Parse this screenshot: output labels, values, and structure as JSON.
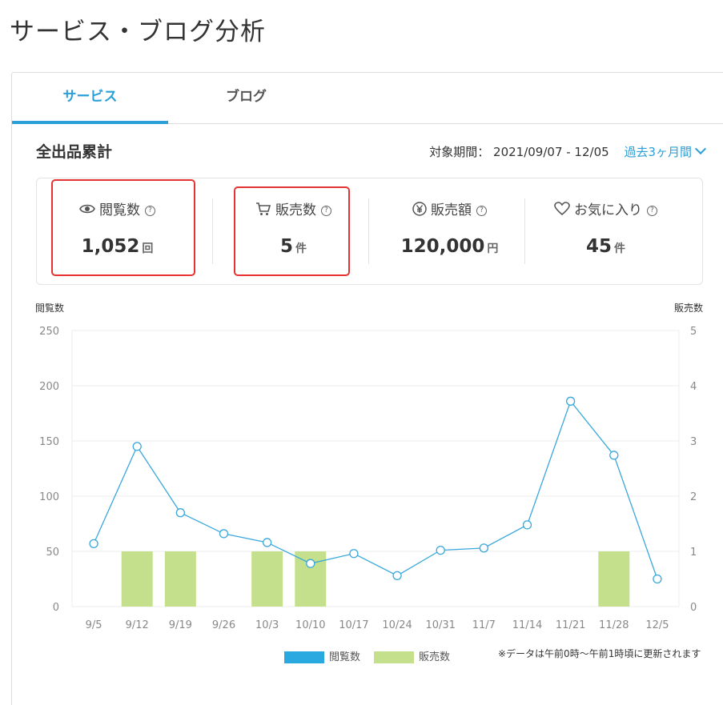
{
  "page": {
    "title": "サービス・ブログ分析"
  },
  "tabs": [
    {
      "label": "サービス",
      "active": true
    },
    {
      "label": "ブログ",
      "active": false
    }
  ],
  "summary": {
    "title": "全出品累計",
    "period_label": "対象期間：",
    "period_value": "2021/09/07 - 12/05",
    "range_select": "過去3ヶ月間",
    "help_glyph": "?"
  },
  "stats": [
    {
      "icon": "eye-icon",
      "label": "閲覧数",
      "value": "1,052",
      "unit": "回"
    },
    {
      "icon": "cart-icon",
      "label": "販売数",
      "value": "5",
      "unit": "件"
    },
    {
      "icon": "yen-icon",
      "label": "販売額",
      "value": "120,000",
      "unit": "円"
    },
    {
      "icon": "heart-icon",
      "label": "お気に入り",
      "value": "45",
      "unit": "件"
    }
  ],
  "colors": {
    "accent": "#2a9fd8",
    "bar": "#c5e08d",
    "line": "#3aa8dc",
    "highlight": "#e53333"
  },
  "chart_data": {
    "type": "bar",
    "y_left_label": "閲覧数",
    "y_right_label": "販売数",
    "categories": [
      "9/5",
      "9/12",
      "9/19",
      "9/26",
      "10/3",
      "10/10",
      "10/17",
      "10/24",
      "10/31",
      "11/7",
      "11/14",
      "11/21",
      "11/28",
      "12/5"
    ],
    "y_left_ticks": [
      "0",
      "50",
      "100",
      "150",
      "200",
      "250"
    ],
    "y_right_ticks": [
      "0",
      "1",
      "2",
      "3",
      "4",
      "5"
    ],
    "ylim_left": [
      0,
      250
    ],
    "ylim_right": [
      0,
      5
    ],
    "series": [
      {
        "name": "閲覧数",
        "type": "line",
        "axis": "left",
        "values": [
          57,
          145,
          85,
          66,
          58,
          39,
          48,
          28,
          51,
          53,
          74,
          186,
          137,
          25
        ]
      },
      {
        "name": "販売数",
        "type": "bar",
        "axis": "right",
        "values": [
          0,
          1,
          1,
          0,
          1,
          1,
          0,
          0,
          0,
          0,
          0,
          0,
          1,
          0
        ]
      }
    ],
    "legend": [
      "閲覧数",
      "販売数"
    ],
    "legend_placement": "bottom",
    "grid": true
  },
  "footnote": "※データは午前0時～午前1時頃に更新されます"
}
